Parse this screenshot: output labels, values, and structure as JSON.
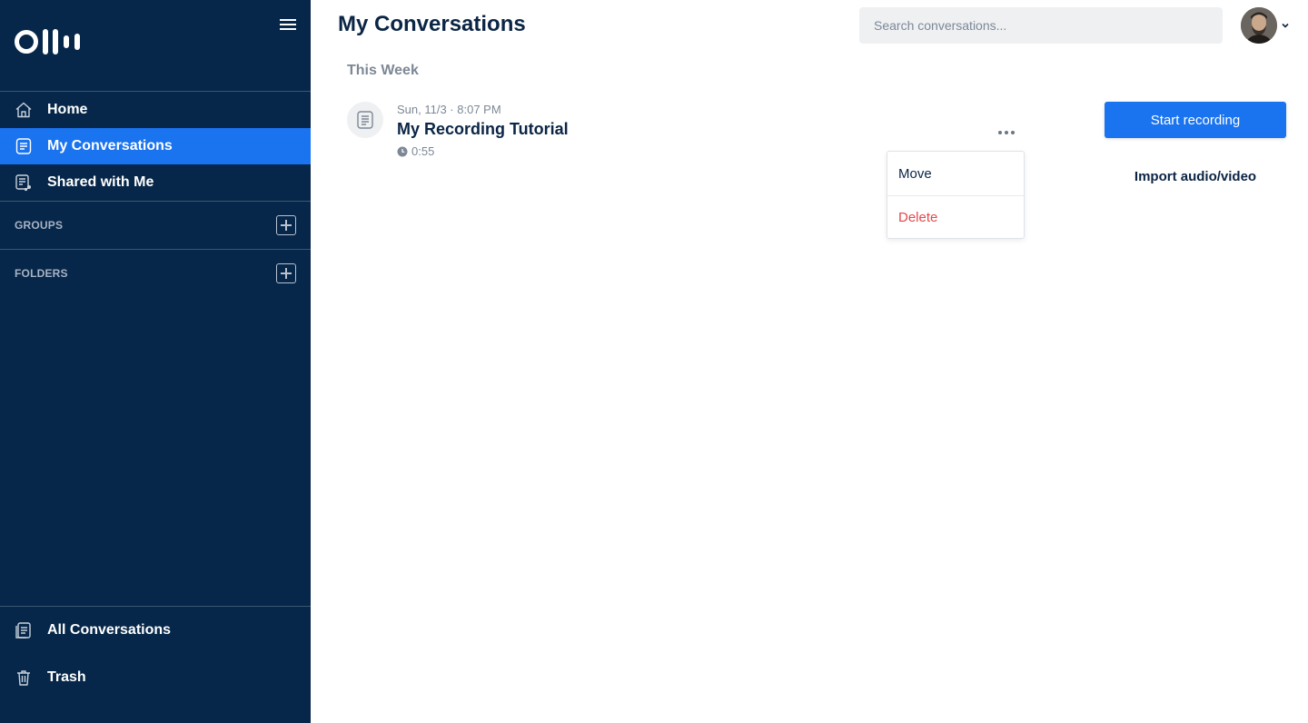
{
  "sidebar": {
    "logo_alt": "Otter",
    "nav": [
      {
        "label": "Home",
        "icon": "home-icon",
        "active": false
      },
      {
        "label": "My Conversations",
        "icon": "document-icon",
        "active": true
      },
      {
        "label": "Shared with Me",
        "icon": "shared-document-icon",
        "active": false
      }
    ],
    "sections": [
      {
        "label": "GROUPS"
      },
      {
        "label": "FOLDERS"
      }
    ],
    "bottom_nav": [
      {
        "label": "All Conversations",
        "icon": "stacked-documents-icon"
      },
      {
        "label": "Trash",
        "icon": "trash-icon"
      }
    ]
  },
  "header": {
    "title": "My Conversations",
    "search_placeholder": "Search conversations..."
  },
  "main": {
    "group_heading": "This Week",
    "conversations": [
      {
        "date": "Sun, 11/3 · 8:07 PM",
        "title": "My Recording Tutorial",
        "duration": "0:55"
      }
    ],
    "context_menu": {
      "items": [
        {
          "label": "Move"
        },
        {
          "label": "Delete"
        }
      ]
    },
    "actions": {
      "start_recording": "Start recording",
      "import": "Import audio/video"
    }
  },
  "colors": {
    "sidebar_bg": "#062749",
    "accent": "#1a73ef",
    "danger": "#e5484d",
    "text_primary": "#0b2545",
    "text_muted": "#7d8896"
  }
}
